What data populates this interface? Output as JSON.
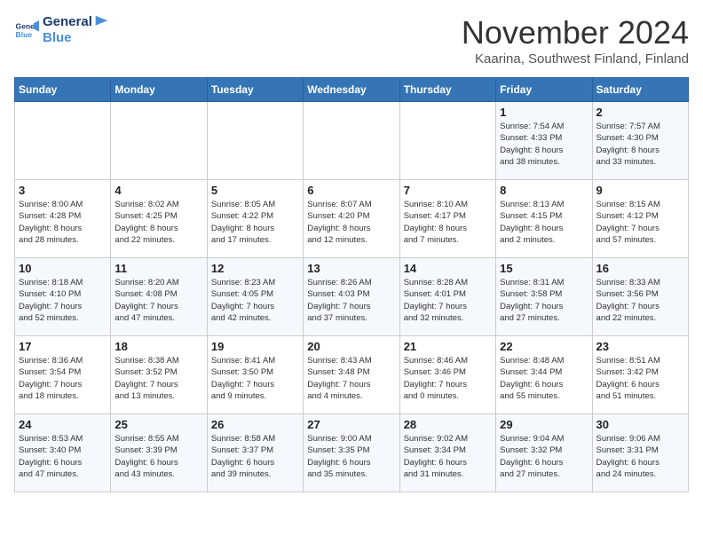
{
  "header": {
    "logo_line1": "General",
    "logo_line2": "Blue",
    "month": "November 2024",
    "location": "Kaarina, Southwest Finland, Finland"
  },
  "weekdays": [
    "Sunday",
    "Monday",
    "Tuesday",
    "Wednesday",
    "Thursday",
    "Friday",
    "Saturday"
  ],
  "weeks": [
    [
      {
        "day": "",
        "info": ""
      },
      {
        "day": "",
        "info": ""
      },
      {
        "day": "",
        "info": ""
      },
      {
        "day": "",
        "info": ""
      },
      {
        "day": "",
        "info": ""
      },
      {
        "day": "1",
        "info": "Sunrise: 7:54 AM\nSunset: 4:33 PM\nDaylight: 8 hours\nand 38 minutes."
      },
      {
        "day": "2",
        "info": "Sunrise: 7:57 AM\nSunset: 4:30 PM\nDaylight: 8 hours\nand 33 minutes."
      }
    ],
    [
      {
        "day": "3",
        "info": "Sunrise: 8:00 AM\nSunset: 4:28 PM\nDaylight: 8 hours\nand 28 minutes."
      },
      {
        "day": "4",
        "info": "Sunrise: 8:02 AM\nSunset: 4:25 PM\nDaylight: 8 hours\nand 22 minutes."
      },
      {
        "day": "5",
        "info": "Sunrise: 8:05 AM\nSunset: 4:22 PM\nDaylight: 8 hours\nand 17 minutes."
      },
      {
        "day": "6",
        "info": "Sunrise: 8:07 AM\nSunset: 4:20 PM\nDaylight: 8 hours\nand 12 minutes."
      },
      {
        "day": "7",
        "info": "Sunrise: 8:10 AM\nSunset: 4:17 PM\nDaylight: 8 hours\nand 7 minutes."
      },
      {
        "day": "8",
        "info": "Sunrise: 8:13 AM\nSunset: 4:15 PM\nDaylight: 8 hours\nand 2 minutes."
      },
      {
        "day": "9",
        "info": "Sunrise: 8:15 AM\nSunset: 4:12 PM\nDaylight: 7 hours\nand 57 minutes."
      }
    ],
    [
      {
        "day": "10",
        "info": "Sunrise: 8:18 AM\nSunset: 4:10 PM\nDaylight: 7 hours\nand 52 minutes."
      },
      {
        "day": "11",
        "info": "Sunrise: 8:20 AM\nSunset: 4:08 PM\nDaylight: 7 hours\nand 47 minutes."
      },
      {
        "day": "12",
        "info": "Sunrise: 8:23 AM\nSunset: 4:05 PM\nDaylight: 7 hours\nand 42 minutes."
      },
      {
        "day": "13",
        "info": "Sunrise: 8:26 AM\nSunset: 4:03 PM\nDaylight: 7 hours\nand 37 minutes."
      },
      {
        "day": "14",
        "info": "Sunrise: 8:28 AM\nSunset: 4:01 PM\nDaylight: 7 hours\nand 32 minutes."
      },
      {
        "day": "15",
        "info": "Sunrise: 8:31 AM\nSunset: 3:58 PM\nDaylight: 7 hours\nand 27 minutes."
      },
      {
        "day": "16",
        "info": "Sunrise: 8:33 AM\nSunset: 3:56 PM\nDaylight: 7 hours\nand 22 minutes."
      }
    ],
    [
      {
        "day": "17",
        "info": "Sunrise: 8:36 AM\nSunset: 3:54 PM\nDaylight: 7 hours\nand 18 minutes."
      },
      {
        "day": "18",
        "info": "Sunrise: 8:38 AM\nSunset: 3:52 PM\nDaylight: 7 hours\nand 13 minutes."
      },
      {
        "day": "19",
        "info": "Sunrise: 8:41 AM\nSunset: 3:50 PM\nDaylight: 7 hours\nand 9 minutes."
      },
      {
        "day": "20",
        "info": "Sunrise: 8:43 AM\nSunset: 3:48 PM\nDaylight: 7 hours\nand 4 minutes."
      },
      {
        "day": "21",
        "info": "Sunrise: 8:46 AM\nSunset: 3:46 PM\nDaylight: 7 hours\nand 0 minutes."
      },
      {
        "day": "22",
        "info": "Sunrise: 8:48 AM\nSunset: 3:44 PM\nDaylight: 6 hours\nand 55 minutes."
      },
      {
        "day": "23",
        "info": "Sunrise: 8:51 AM\nSunset: 3:42 PM\nDaylight: 6 hours\nand 51 minutes."
      }
    ],
    [
      {
        "day": "24",
        "info": "Sunrise: 8:53 AM\nSunset: 3:40 PM\nDaylight: 6 hours\nand 47 minutes."
      },
      {
        "day": "25",
        "info": "Sunrise: 8:55 AM\nSunset: 3:39 PM\nDaylight: 6 hours\nand 43 minutes."
      },
      {
        "day": "26",
        "info": "Sunrise: 8:58 AM\nSunset: 3:37 PM\nDaylight: 6 hours\nand 39 minutes."
      },
      {
        "day": "27",
        "info": "Sunrise: 9:00 AM\nSunset: 3:35 PM\nDaylight: 6 hours\nand 35 minutes."
      },
      {
        "day": "28",
        "info": "Sunrise: 9:02 AM\nSunset: 3:34 PM\nDaylight: 6 hours\nand 31 minutes."
      },
      {
        "day": "29",
        "info": "Sunrise: 9:04 AM\nSunset: 3:32 PM\nDaylight: 6 hours\nand 27 minutes."
      },
      {
        "day": "30",
        "info": "Sunrise: 9:06 AM\nSunset: 3:31 PM\nDaylight: 6 hours\nand 24 minutes."
      }
    ]
  ]
}
